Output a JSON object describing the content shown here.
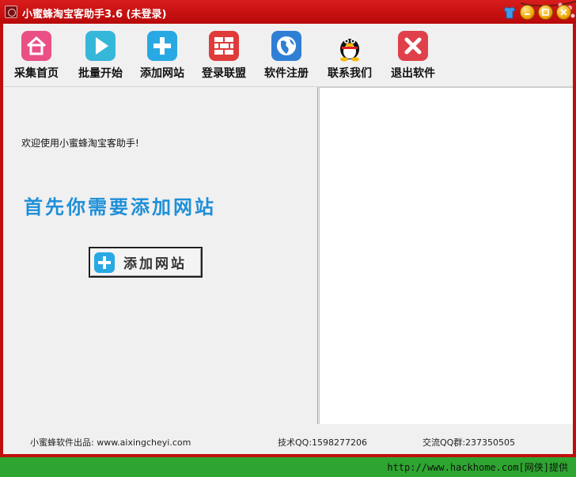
{
  "window": {
    "title": "小蜜蜂淘宝客助手3.6  (未登录)",
    "accent_color": "#c00d0d",
    "controls": [
      {
        "name": "skin",
        "icon": "shirt-icon"
      },
      {
        "name": "minimize",
        "icon": "minimize-icon"
      },
      {
        "name": "maximize",
        "icon": "maximize-icon"
      },
      {
        "name": "close",
        "icon": "close-icon"
      }
    ]
  },
  "toolbar": {
    "items": [
      {
        "label": "采集首页",
        "icon": "home-icon"
      },
      {
        "label": "批量开始",
        "icon": "play-icon"
      },
      {
        "label": "添加网站",
        "icon": "plus-icon"
      },
      {
        "label": "登录联盟",
        "icon": "brick-wall-icon"
      },
      {
        "label": "软件注册",
        "icon": "globe-icon"
      },
      {
        "label": "联系我们",
        "icon": "qq-penguin-icon"
      },
      {
        "label": "退出软件",
        "icon": "exit-x-icon"
      }
    ]
  },
  "main": {
    "welcome": "欢迎使用小蜜蜂淘宝客助手!",
    "headline": "首先你需要添加网站",
    "add_button_label": "添加网站"
  },
  "footer": {
    "credit": "小蜜蜂软件出品: www.aixingcheyi.com",
    "tech_qq": "技术QQ:1598277206",
    "group_qq": "交流QQ群:237350505"
  },
  "watermark": "http://www.hackhome.com[网侠]提供"
}
